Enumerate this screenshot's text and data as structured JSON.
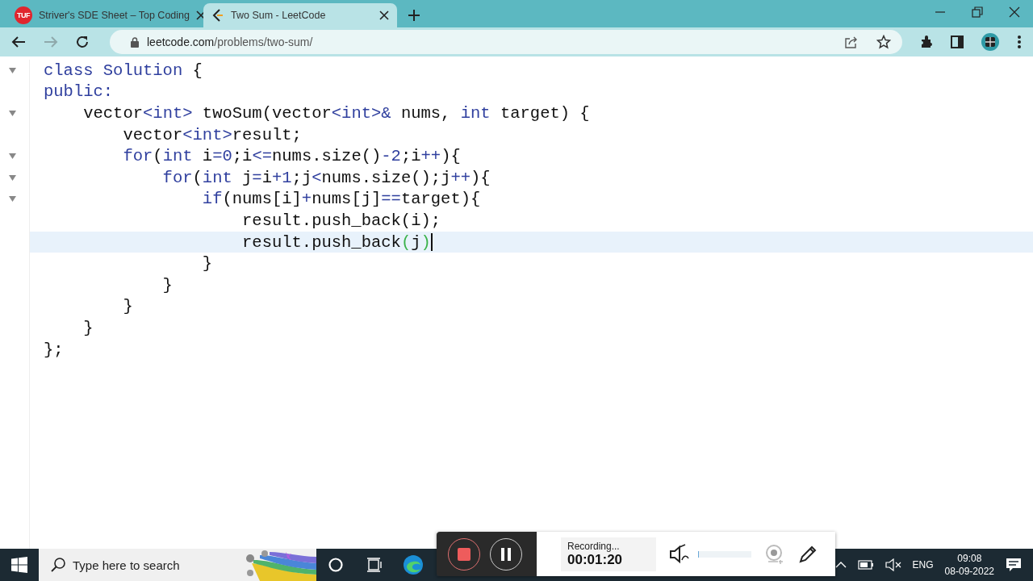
{
  "browser": {
    "tabs": [
      {
        "title": "Striver's SDE Sheet – Top Coding",
        "favicon_text": "TUF",
        "selected": false
      },
      {
        "title": "Two Sum - LeetCode",
        "selected": true
      }
    ],
    "address": {
      "host": "leetcode.com",
      "path": "/problems/two-sum/"
    },
    "forward_disabled": true
  },
  "editor": {
    "lines": [
      {
        "foldable": true,
        "current": false,
        "tokens": [
          {
            "kind": "keyword",
            "text": "class Solution"
          },
          {
            "kind": "plain",
            "text": " {"
          }
        ]
      },
      {
        "foldable": false,
        "current": false,
        "tokens": [
          {
            "kind": "keyword",
            "text": "public:"
          }
        ]
      },
      {
        "foldable": true,
        "current": false,
        "tokens": [
          {
            "kind": "plain",
            "text": "    vector"
          },
          {
            "kind": "keyword",
            "text": "<int>"
          },
          {
            "kind": "plain",
            "text": " twoSum(vector"
          },
          {
            "kind": "keyword",
            "text": "<int>&"
          },
          {
            "kind": "plain",
            "text": " nums, "
          },
          {
            "kind": "keyword",
            "text": "int"
          },
          {
            "kind": "plain",
            "text": " target) {"
          }
        ]
      },
      {
        "foldable": false,
        "current": false,
        "tokens": [
          {
            "kind": "plain",
            "text": "        vector"
          },
          {
            "kind": "keyword",
            "text": "<int>"
          },
          {
            "kind": "plain",
            "text": "result;"
          }
        ]
      },
      {
        "foldable": true,
        "current": false,
        "tokens": [
          {
            "kind": "keyword",
            "text": "        for"
          },
          {
            "kind": "plain",
            "text": "("
          },
          {
            "kind": "keyword",
            "text": "int"
          },
          {
            "kind": "plain",
            "text": " i"
          },
          {
            "kind": "keyword",
            "text": "=0"
          },
          {
            "kind": "plain",
            "text": ";i"
          },
          {
            "kind": "keyword",
            "text": "<="
          },
          {
            "kind": "plain",
            "text": "nums.size()"
          },
          {
            "kind": "keyword",
            "text": "-2"
          },
          {
            "kind": "plain",
            "text": ";i"
          },
          {
            "kind": "keyword",
            "text": "++"
          },
          {
            "kind": "plain",
            "text": "){"
          }
        ]
      },
      {
        "foldable": true,
        "current": false,
        "tokens": [
          {
            "kind": "keyword",
            "text": "            for"
          },
          {
            "kind": "plain",
            "text": "("
          },
          {
            "kind": "keyword",
            "text": "int"
          },
          {
            "kind": "plain",
            "text": " j"
          },
          {
            "kind": "keyword",
            "text": "="
          },
          {
            "kind": "plain",
            "text": "i"
          },
          {
            "kind": "keyword",
            "text": "+1"
          },
          {
            "kind": "plain",
            "text": ";j"
          },
          {
            "kind": "keyword",
            "text": "<"
          },
          {
            "kind": "plain",
            "text": "nums.size();j"
          },
          {
            "kind": "keyword",
            "text": "++"
          },
          {
            "kind": "plain",
            "text": "){"
          }
        ]
      },
      {
        "foldable": true,
        "current": false,
        "tokens": [
          {
            "kind": "keyword",
            "text": "                if"
          },
          {
            "kind": "plain",
            "text": "(nums[i]"
          },
          {
            "kind": "keyword",
            "text": "+"
          },
          {
            "kind": "plain",
            "text": "nums[j]"
          },
          {
            "kind": "keyword",
            "text": "=="
          },
          {
            "kind": "plain",
            "text": "target){"
          }
        ]
      },
      {
        "foldable": false,
        "current": false,
        "tokens": [
          {
            "kind": "plain",
            "text": "                    result.push_back(i);"
          }
        ]
      },
      {
        "foldable": false,
        "current": true,
        "tokens": [
          {
            "kind": "plain",
            "text": "                    result.push_back"
          },
          {
            "kind": "bracket",
            "text": "("
          },
          {
            "kind": "plain",
            "text": "j"
          },
          {
            "kind": "bracket",
            "text": ")"
          }
        ]
      },
      {
        "foldable": false,
        "current": false,
        "tokens": [
          {
            "kind": "plain",
            "text": "                }"
          }
        ]
      },
      {
        "foldable": false,
        "current": false,
        "tokens": [
          {
            "kind": "plain",
            "text": "            }"
          }
        ]
      },
      {
        "foldable": false,
        "current": false,
        "tokens": [
          {
            "kind": "plain",
            "text": "        }"
          }
        ]
      },
      {
        "foldable": false,
        "current": false,
        "tokens": [
          {
            "kind": "plain",
            "text": "    }"
          }
        ]
      },
      {
        "foldable": false,
        "current": false,
        "tokens": [
          {
            "kind": "plain",
            "text": "};"
          }
        ]
      }
    ]
  },
  "recorder": {
    "status": "Recording...",
    "elapsed": "00:01:20",
    "volume": {
      "level": 0.02
    }
  },
  "taskbar": {
    "search": {
      "placeholder": "Type here to search"
    },
    "language": "ENG",
    "time": "09:08",
    "date": "08-09-2022"
  }
}
